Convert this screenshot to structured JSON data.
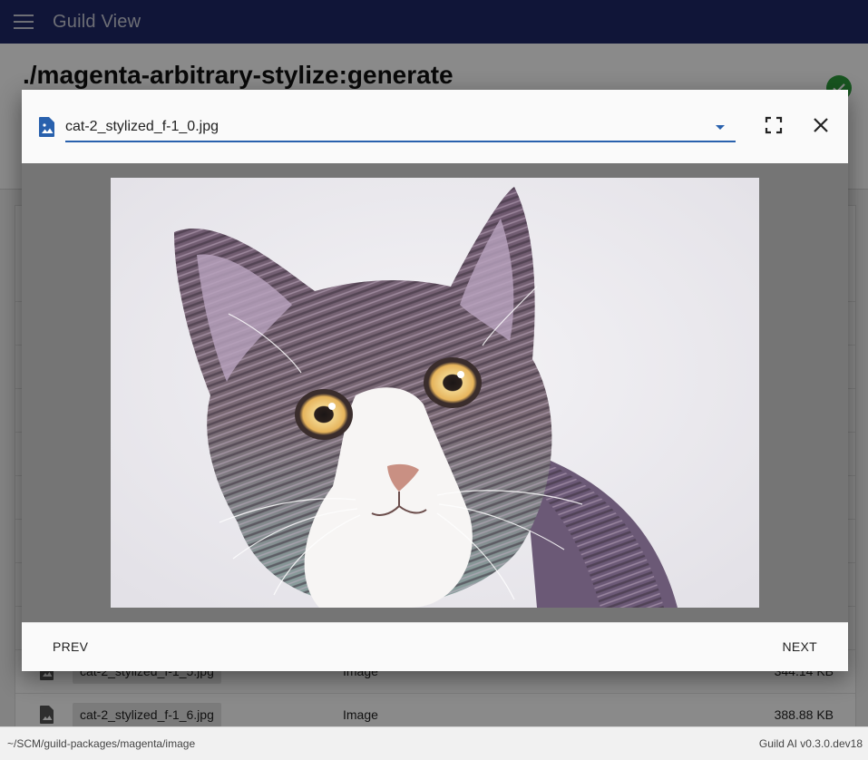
{
  "app": {
    "title": "Guild View"
  },
  "page": {
    "title": "./magenta-arbitrary-stylize:generate",
    "status": "completed"
  },
  "files": [
    {
      "name": "cat-2_stylized_f-1_5.jpg",
      "type": "Image",
      "size": "344.14 KB"
    },
    {
      "name": "cat-2_stylized_f-1_6.jpg",
      "type": "Image",
      "size": "388.88 KB"
    }
  ],
  "footer": {
    "path": "~/SCM/guild-packages/magenta/image",
    "version": "Guild AI v0.3.0.dev18"
  },
  "viewer": {
    "selected_file": "cat-2_stylized_f-1_0.jpg",
    "prev_label": "PREV",
    "next_label": "NEXT",
    "icons": {
      "file": "image-file-icon",
      "fullscreen": "fullscreen-icon",
      "close": "close-icon",
      "dropdown": "chevron-down-icon"
    }
  },
  "colors": {
    "appbar": "#1e2868",
    "accent": "#2961ad",
    "success": "#2e9d3c"
  }
}
